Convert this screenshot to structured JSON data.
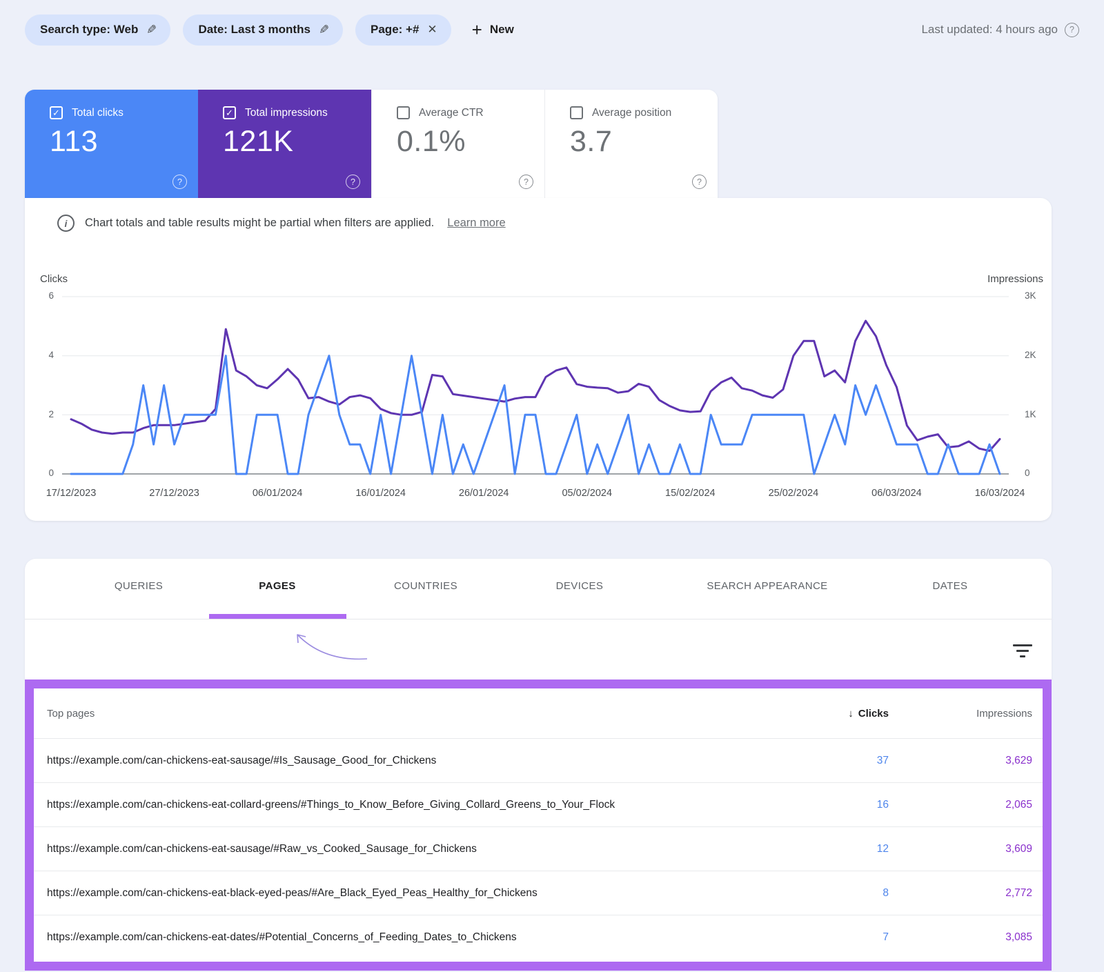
{
  "appearance": {
    "background": "#edf0f9",
    "chip_bg": "#d7e3fc",
    "clicks_blue": "#4b87f6",
    "impressions_purple": "#5e35b1",
    "highlight_purple": "#ad6af1",
    "table_clicks_color": "#4f86ec",
    "table_impressions_color": "#8a30cc"
  },
  "icons": {
    "pencil": "✎",
    "close": "✕",
    "plus": "+",
    "help": "?",
    "check": "✓",
    "sort_desc": "↓",
    "info": "i"
  },
  "topbar": {
    "chips": [
      {
        "label": "Search type: Web",
        "action": "edit"
      },
      {
        "label": "Date: Last 3 months",
        "action": "edit"
      },
      {
        "label": "Page: +#",
        "action": "remove"
      }
    ],
    "new_label": "New",
    "last_updated": "Last updated: 4 hours ago"
  },
  "metrics": [
    {
      "label": "Total clicks",
      "value": "113",
      "checked": true
    },
    {
      "label": "Total impressions",
      "value": "121K",
      "checked": true
    },
    {
      "label": "Average CTR",
      "value": "0.1%",
      "checked": false
    },
    {
      "label": "Average position",
      "value": "3.7",
      "checked": false
    }
  ],
  "banner": {
    "text": "Chart totals and table results might be partial when filters are applied.",
    "link": "Learn more"
  },
  "chart_data": {
    "type": "line",
    "title": "Clicks and impressions over last 3 months (daily)",
    "x_start": "17/12/2023",
    "x_end": "16/03/2024",
    "x_labels": [
      "17/12/2023",
      "27/12/2023",
      "06/01/2024",
      "16/01/2024",
      "26/01/2024",
      "05/02/2024",
      "15/02/2024",
      "25/02/2024",
      "06/03/2024",
      "16/03/2024"
    ],
    "left_axis": {
      "title": "Clicks",
      "ticks": [
        "6",
        "4",
        "2",
        "0"
      ],
      "max": 6
    },
    "right_axis": {
      "title": "Impressions",
      "ticks": [
        "3K",
        "2K",
        "1K",
        "0"
      ],
      "max": 3000
    },
    "grid": true,
    "legend_position": "none",
    "series": [
      {
        "name": "Clicks",
        "axis": "left",
        "color": "#4b87f6",
        "values": [
          0,
          0,
          0,
          0,
          0,
          0,
          1,
          3,
          1,
          3,
          1,
          2,
          2,
          2,
          2,
          4,
          0,
          0,
          2,
          2,
          2,
          0,
          0,
          2,
          3,
          4,
          2,
          1,
          1,
          0,
          2,
          0,
          2,
          4,
          2,
          0,
          2,
          0,
          1,
          0,
          1,
          2,
          3,
          0,
          2,
          2,
          0,
          0,
          1,
          2,
          0,
          1,
          0,
          1,
          2,
          0,
          1,
          0,
          0,
          1,
          0,
          0,
          2,
          1,
          1,
          1,
          2,
          2,
          2,
          2,
          2,
          2,
          0,
          1,
          2,
          1,
          3,
          2,
          3,
          2,
          1,
          1,
          1,
          0,
          0,
          1,
          0,
          0,
          0,
          1,
          0
        ]
      },
      {
        "name": "Impressions",
        "axis": "right",
        "color": "#5e35b1",
        "values": [
          925,
          850,
          750,
          700,
          680,
          700,
          700,
          775,
          825,
          825,
          825,
          850,
          875,
          900,
          1100,
          2450,
          1750,
          1650,
          1500,
          1450,
          1600,
          1775,
          1600,
          1280,
          1300,
          1225,
          1175,
          1300,
          1330,
          1280,
          1100,
          1030,
          1000,
          1000,
          1050,
          1675,
          1650,
          1350,
          1325,
          1300,
          1275,
          1250,
          1225,
          1275,
          1300,
          1300,
          1640,
          1750,
          1800,
          1520,
          1475,
          1460,
          1450,
          1375,
          1400,
          1525,
          1475,
          1250,
          1150,
          1075,
          1050,
          1060,
          1400,
          1550,
          1630,
          1450,
          1410,
          1330,
          1290,
          1430,
          2000,
          2250,
          2250,
          1650,
          1750,
          1550,
          2250,
          2590,
          2330,
          1840,
          1470,
          820,
          570,
          630,
          670,
          450,
          470,
          550,
          430,
          390,
          590
        ]
      }
    ]
  },
  "tabs": {
    "items": [
      "QUERIES",
      "PAGES",
      "COUNTRIES",
      "DEVICES",
      "SEARCH APPEARANCE",
      "DATES"
    ],
    "active": "PAGES"
  },
  "table": {
    "columns": {
      "pages": "Top pages",
      "clicks": "Clicks",
      "impressions": "Impressions"
    },
    "sorted_by": "Clicks",
    "sort_direction": "desc",
    "rows": [
      {
        "page": "https://example.com/can-chickens-eat-sausage/#Is_Sausage_Good_for_Chickens",
        "clicks": "37",
        "impressions": "3,629"
      },
      {
        "page": "https://example.com/can-chickens-eat-collard-greens/#Things_to_Know_Before_Giving_Collard_Greens_to_Your_Flock",
        "clicks": "16",
        "impressions": "2,065"
      },
      {
        "page": "https://example.com/can-chickens-eat-sausage/#Raw_vs_Cooked_Sausage_for_Chickens",
        "clicks": "12",
        "impressions": "3,609"
      },
      {
        "page": "https://example.com/can-chickens-eat-black-eyed-peas/#Are_Black_Eyed_Peas_Healthy_for_Chickens",
        "clicks": "8",
        "impressions": "2,772"
      },
      {
        "page": "https://example.com/can-chickens-eat-dates/#Potential_Concerns_of_Feeding_Dates_to_Chickens",
        "clicks": "7",
        "impressions": "3,085"
      }
    ]
  }
}
